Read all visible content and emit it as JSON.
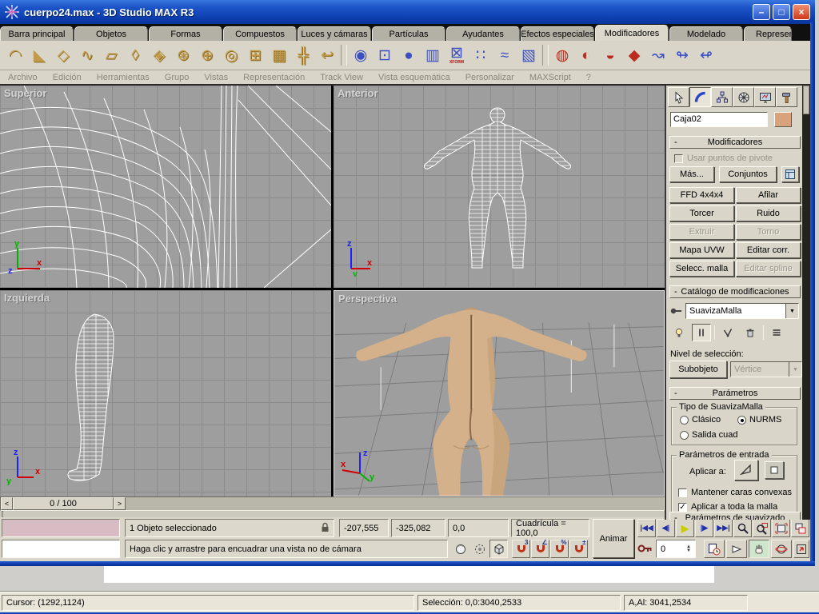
{
  "window": {
    "title": "cuerpo24.max - 3D Studio MAX R3",
    "minimize_glyph": "–",
    "maximize_glyph": "□",
    "close_glyph": "×"
  },
  "tabs": [
    {
      "label": "Barra principal"
    },
    {
      "label": "Objetos"
    },
    {
      "label": "Formas"
    },
    {
      "label": "Compuestos"
    },
    {
      "label": "Luces y cámaras"
    },
    {
      "label": "Partículas"
    },
    {
      "label": "Ayudantes"
    },
    {
      "label": "Efectos especiales"
    },
    {
      "label": "Modificadores",
      "cls": "active"
    },
    {
      "label": "Modelado"
    },
    {
      "label": "Representación",
      "cls": "clipped"
    }
  ],
  "menus": [
    {
      "label": "Archivo"
    },
    {
      "label": "Edición"
    },
    {
      "label": "Herramientas"
    },
    {
      "label": "Grupo"
    },
    {
      "label": "Vistas"
    },
    {
      "label": "Representación"
    },
    {
      "label": "Track View"
    },
    {
      "label": "Vista esquemática"
    },
    {
      "label": "Personalizar"
    },
    {
      "label": "MAXScript"
    },
    {
      "label": "?"
    }
  ],
  "toolbar_icons": [
    {
      "name": "bend-icon",
      "glyph": "◠",
      "cls": "tan"
    },
    {
      "name": "taper-icon",
      "glyph": "◣",
      "cls": "tan"
    },
    {
      "name": "twist-icon",
      "glyph": "◇",
      "cls": "tan"
    },
    {
      "name": "noise-icon",
      "glyph": "∿",
      "cls": "tan"
    },
    {
      "name": "skew-icon",
      "glyph": "▱",
      "cls": "tan"
    },
    {
      "name": "stretch-icon",
      "glyph": "◊",
      "cls": "tan"
    },
    {
      "name": "squeeze-icon",
      "glyph": "◈",
      "cls": "tan"
    },
    {
      "name": "explode-icon",
      "glyph": "⊛",
      "cls": "tan"
    },
    {
      "name": "sphere-gizmo-icon",
      "glyph": "⊕",
      "cls": "tan"
    },
    {
      "name": "ripple-icon",
      "glyph": "◎",
      "cls": "tan"
    },
    {
      "name": "ffd-box-icon",
      "glyph": "⊞",
      "cls": "tan"
    },
    {
      "name": "ffd-lattice-icon",
      "glyph": "▦",
      "cls": "tan"
    },
    {
      "name": "xform-move-icon",
      "glyph": "╬",
      "cls": "tan"
    },
    {
      "name": "mirror-icon",
      "glyph": "↩",
      "cls": "tan"
    },
    {
      "name": "toolbar-divider",
      "glyph": "",
      "cls": "divider"
    },
    {
      "name": "camera-icon",
      "glyph": "◉",
      "cls": "blue"
    },
    {
      "name": "linked-xform-icon",
      "glyph": "⊡",
      "cls": "blue"
    },
    {
      "name": "sphere-icon",
      "glyph": "●",
      "cls": "blue"
    },
    {
      "name": "cylinder-icon",
      "glyph": "▥",
      "cls": "blue"
    },
    {
      "name": "xform-icon",
      "glyph": "⊠",
      "sub": "XFORM",
      "cls": "blue"
    },
    {
      "name": "ffd-points-icon",
      "glyph": "∷",
      "cls": "blue"
    },
    {
      "name": "spray-icon",
      "glyph": "≈",
      "cls": "blue"
    },
    {
      "name": "lattice-cube-icon",
      "glyph": "▧",
      "cls": "blue"
    },
    {
      "name": "toolbar-divider-2",
      "glyph": "",
      "cls": "divider"
    },
    {
      "name": "scatter-icon",
      "glyph": "◍",
      "cls": "red"
    },
    {
      "name": "displace-globe-icon",
      "glyph": "◐",
      "cls": "red"
    },
    {
      "name": "patch-icon",
      "glyph": "◒",
      "cls": "red"
    },
    {
      "name": "surface-icon",
      "glyph": "◆",
      "cls": "red"
    },
    {
      "name": "spline-edit-icon",
      "glyph": "↝",
      "cls": "blue"
    },
    {
      "name": "spline-box-icon",
      "glyph": "↬",
      "cls": "blue"
    },
    {
      "name": "spline-curve-icon",
      "glyph": "↫",
      "cls": "blue"
    }
  ],
  "viewports": {
    "superior": "Superior",
    "anterior": "Anterior",
    "izquierda": "Izquierda",
    "perspectiva": "Perspectiva"
  },
  "axes": {
    "x": "x",
    "y": "y",
    "z": "z"
  },
  "timeline": {
    "prev": "<",
    "next": ">",
    "frame_label": "0 / 100",
    "trackbar_mark": "["
  },
  "status": {
    "selection": "1 Objeto seleccionado",
    "coord_x": "-207,555",
    "coord_y": "-325,082",
    "coord_z": "0,0",
    "grid": "Cuadrícula = 100,0",
    "animate": "Animar",
    "prompt": "Haga clic y arrastre para encuadrar una vista no de cámara",
    "frame_field": "0",
    "snaps": [
      {
        "name": "snap-3d-icon",
        "label": "3"
      },
      {
        "name": "snap-angle-icon",
        "label": "∠"
      },
      {
        "name": "snap-percent-icon",
        "label": "%"
      },
      {
        "name": "snap-spinner-icon",
        "label": "±"
      }
    ]
  },
  "panel": {
    "name_value": "Caja02",
    "swatch_color": "#d8a37c",
    "rollout_modifiers": "Modificadores",
    "rollout_catalog": "Catálogo de modificaciones",
    "rollout_params": "Parámetros",
    "rollout_params2": "Parámetros de suavizado",
    "minus": "-",
    "use_pivot": "Usar puntos de pivote",
    "more": "Más...",
    "sets": "Conjuntos",
    "mod_buttons": [
      {
        "label": "FFD 4x4x4"
      },
      {
        "label": "Afilar"
      },
      {
        "label": "Torcer"
      },
      {
        "label": "Ruido"
      },
      {
        "label": "Extruir",
        "cls": "disabled"
      },
      {
        "label": "Torno",
        "cls": "disabled"
      },
      {
        "label": "Mapa UVW"
      },
      {
        "label": "Editar corr."
      },
      {
        "label": "Selecc. malla"
      },
      {
        "label": "Editar spline",
        "cls": "disabled"
      }
    ],
    "stack_value": "SuavizaMalla",
    "selection_level": "Nivel de selección:",
    "subobject": "Subobjeto",
    "vertex": "Vértice",
    "type_group": "Tipo de SuavizaMalla",
    "radio_classic": "Clásico",
    "radio_nurms": "NURMS",
    "radio_quad": "Salida cuad",
    "input_group": "Parámetros de entrada",
    "apply_to": "Aplicar a:",
    "chk_convex": "Mantener caras convexas",
    "chk_whole": "Aplicar a toda la malla",
    "check_glyph": "✓"
  },
  "bottom_bar": {
    "cursor": "Cursor: (1292,1124)",
    "selection": "Selección: 0,0:3040,2533",
    "size": "A,Al: 3041,2534"
  },
  "colors": {
    "titlebar_blue": "#0c3cae",
    "viewport_gray": "#9e9e9e",
    "skin": "#d4b18a",
    "swatch": "#d8a37c"
  }
}
